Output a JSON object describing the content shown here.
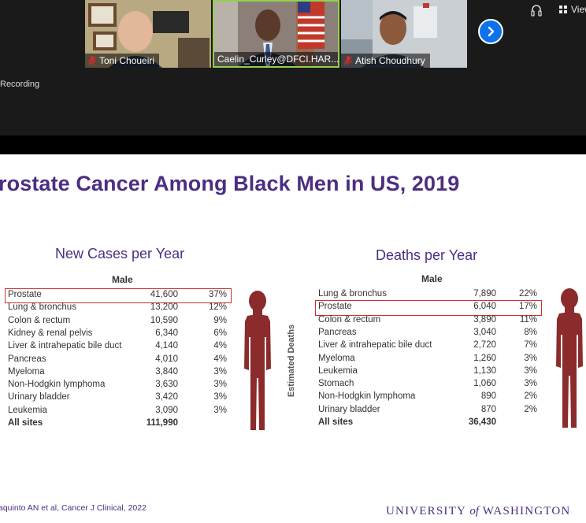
{
  "meeting": {
    "participants": [
      {
        "name": "Toni Choueiri",
        "muted": true
      },
      {
        "name": "Caelin_Curley@DFCI.HAR...",
        "muted": false
      },
      {
        "name": "Atish Choudhury",
        "muted": true
      }
    ],
    "recording_label": "Recording",
    "view_label": "View",
    "icons": {
      "next": "chevron-right-icon",
      "mic": "mic-muted-icon",
      "view": "grid-view-icon",
      "status": "headphones-icon"
    },
    "colors": {
      "accent": "#0e72ed",
      "muted": "#e02828"
    }
  },
  "slide": {
    "title": "rostate Cancer Among Black Men in US, 2019",
    "new_cases": {
      "title": "New Cases per Year",
      "sex": "Male",
      "highlight": "Prostate",
      "rows": [
        {
          "site": "Prostate",
          "count": "41,600",
          "pct": "37%"
        },
        {
          "site": "Lung & bronchus",
          "count": "13,200",
          "pct": "12%"
        },
        {
          "site": "Colon & rectum",
          "count": "10,590",
          "pct": "9%"
        },
        {
          "site": "Kidney & renal pelvis",
          "count": "6,340",
          "pct": "6%"
        },
        {
          "site": "Liver & intrahepatic bile duct",
          "count": "4,140",
          "pct": "4%"
        },
        {
          "site": "Pancreas",
          "count": "4,010",
          "pct": "4%"
        },
        {
          "site": "Myeloma",
          "count": "3,840",
          "pct": "3%"
        },
        {
          "site": "Non-Hodgkin lymphoma",
          "count": "3,630",
          "pct": "3%"
        },
        {
          "site": "Urinary bladder",
          "count": "3,420",
          "pct": "3%"
        },
        {
          "site": "Leukemia",
          "count": "3,090",
          "pct": "3%"
        }
      ],
      "total": {
        "site": "All sites",
        "count": "111,990",
        "pct": ""
      }
    },
    "deaths": {
      "title": "Deaths per Year",
      "sex": "Male",
      "y_label": "Estimated Deaths",
      "highlight": "Prostate",
      "rows": [
        {
          "site": "Lung & bronchus",
          "count": "7,890",
          "pct": "22%"
        },
        {
          "site": "Prostate",
          "count": "6,040",
          "pct": "17%"
        },
        {
          "site": "Colon & rectum",
          "count": "3,890",
          "pct": "11%"
        },
        {
          "site": "Pancreas",
          "count": "3,040",
          "pct": "8%"
        },
        {
          "site": "Liver & intrahepatic bile duct",
          "count": "2,720",
          "pct": "7%"
        },
        {
          "site": "Myeloma",
          "count": "1,260",
          "pct": "3%"
        },
        {
          "site": "Leukemia",
          "count": "1,130",
          "pct": "3%"
        },
        {
          "site": "Stomach",
          "count": "1,060",
          "pct": "3%"
        },
        {
          "site": "Non-Hodgkin lymphoma",
          "count": "890",
          "pct": "2%"
        },
        {
          "site": "Urinary bladder",
          "count": "870",
          "pct": "2%"
        }
      ],
      "total": {
        "site": "All sites",
        "count": "36,430",
        "pct": ""
      }
    },
    "citation": "aquinto AN et al, Cancer J Clinical, 2022",
    "logo": {
      "pre": "UNIVERSITY ",
      "of": "of",
      "post": " WASHINGTON"
    },
    "colors": {
      "title": "#4b2e83",
      "silhouette": "#8b2b2b",
      "highlight_box": "#d03030"
    }
  }
}
